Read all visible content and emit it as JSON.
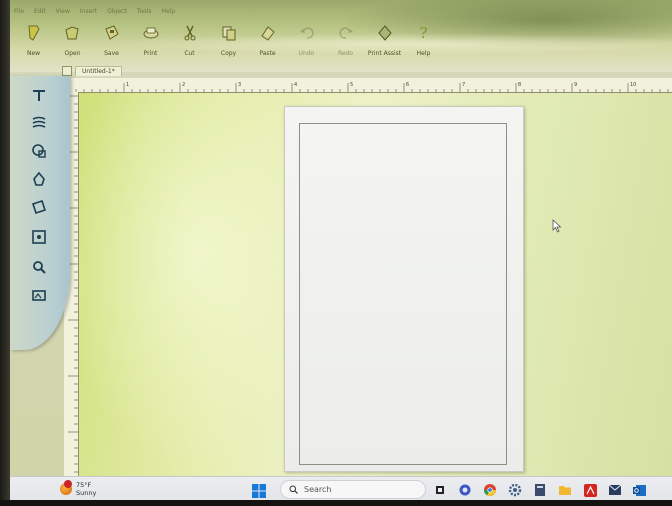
{
  "menu": [
    "File",
    "Edit",
    "View",
    "Insert",
    "Object",
    "Tools",
    "Help"
  ],
  "toolbar": [
    {
      "label": "New",
      "icon": "new-icon"
    },
    {
      "label": "Open",
      "icon": "open-icon"
    },
    {
      "label": "Save",
      "icon": "save-icon"
    },
    {
      "label": "Print",
      "icon": "print-icon"
    },
    {
      "label": "Cut",
      "icon": "cut-icon"
    },
    {
      "label": "Copy",
      "icon": "copy-icon"
    },
    {
      "label": "Paste",
      "icon": "paste-icon"
    },
    {
      "label": "Undo",
      "icon": "undo-icon"
    },
    {
      "label": "Redo",
      "icon": "redo-icon"
    },
    {
      "label": "Print Assist",
      "icon": "print-assist-icon"
    },
    {
      "label": "Help",
      "icon": "help-icon"
    }
  ],
  "document": {
    "tab_label": "Untitled-1*"
  },
  "palette": [
    "text-tool-icon",
    "warp-text-icon",
    "shape-tool-icon",
    "clipart-tool-icon",
    "picture-tool-icon",
    "frame-tool-icon",
    "zoom-tool-icon",
    "photo-tool-icon"
  ],
  "ruler": {
    "top_numbers": [
      "1",
      "2",
      "3",
      "4",
      "5",
      "6",
      "7",
      "8",
      "9",
      "10"
    ]
  },
  "taskbar": {
    "weather_temp": "75°F",
    "weather_cond": "Sunny",
    "search_placeholder": "Search",
    "apps": [
      "file-explorer-icon",
      "chat-icon",
      "chrome-icon",
      "settings-icon",
      "calculator-icon",
      "folder-icon",
      "acrobat-icon",
      "mail-icon",
      "outlook-icon"
    ]
  },
  "colors": {
    "accent": "#8fa45a",
    "workspace": "#e4ecb0"
  }
}
